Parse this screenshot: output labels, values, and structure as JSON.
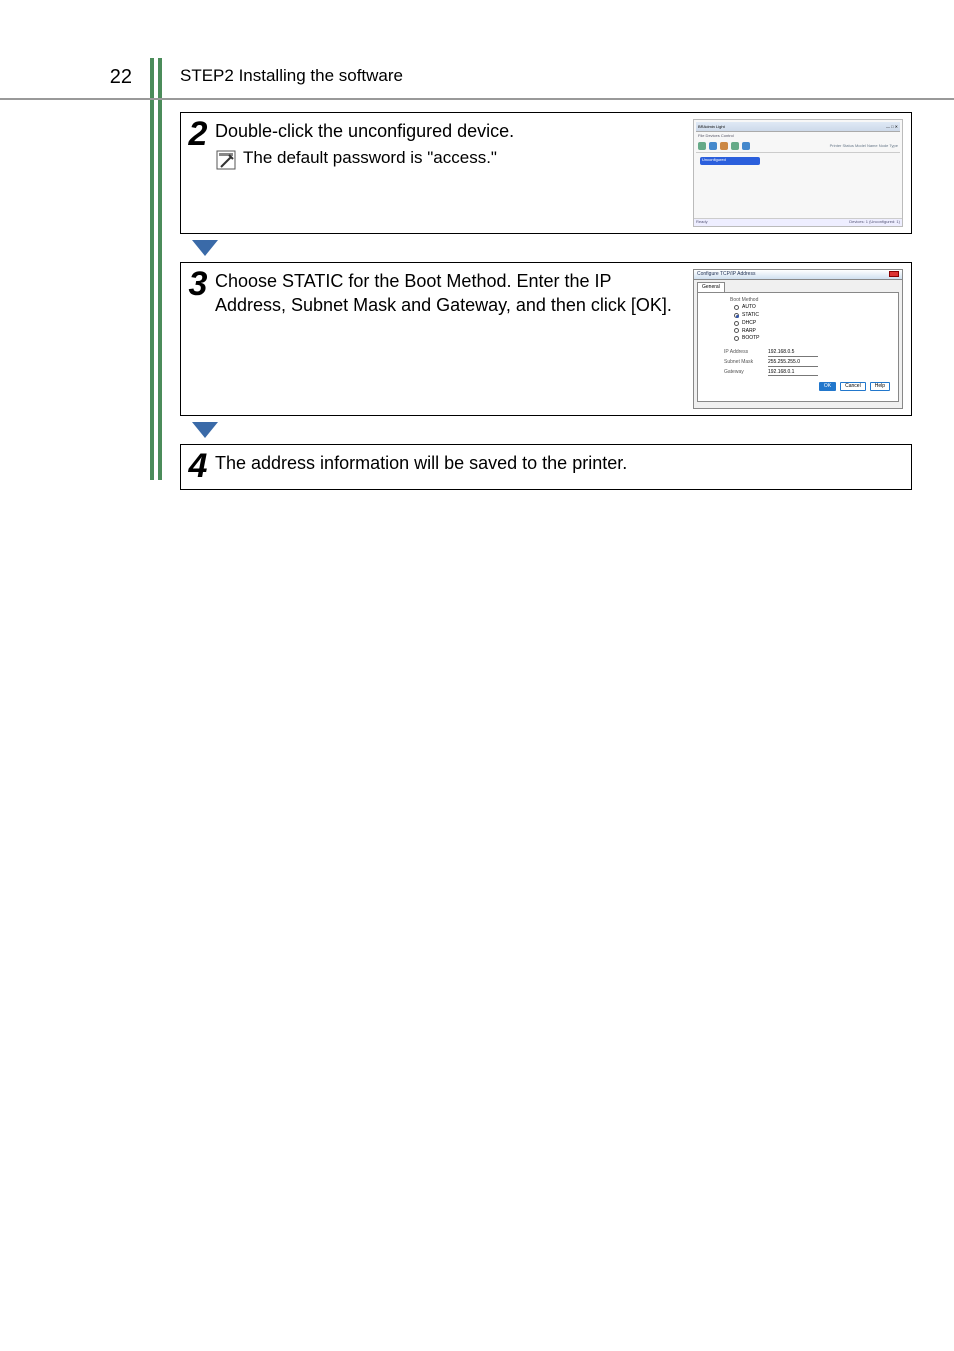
{
  "page_number": "22",
  "header_title": "STEP2 Installing the software",
  "steps": {
    "s2": {
      "num": "2",
      "text": "Double-click the unconfigured device.",
      "note": "The default password is \"access.\""
    },
    "s3": {
      "num": "3",
      "text": "Choose STATIC for the Boot Method. Enter the IP Address, Subnet Mask and Gateway, and then click [OK]."
    },
    "s4": {
      "num": "4",
      "text": "The address information will be saved to the printer."
    }
  },
  "thumb1": {
    "title": "BRAdmin Light",
    "menu": "File Devices Control",
    "cols": "Printer Status      Model Name      Node Type",
    "row": "Unconfigured",
    "status_left": "Ready",
    "status_right": "Devices: 1 (Unconfigured: 1)"
  },
  "thumb2": {
    "title": "Configure TCP/IP Address",
    "tab": "General",
    "legend": "Boot Method",
    "opts": {
      "auto": "AUTO",
      "static": "STATIC",
      "dhcp": "DHCP",
      "rarp": "RARP",
      "bootp": "BOOTP"
    },
    "ip_label": "IP Address",
    "ip_val": "192.168.0.5",
    "sm_label": "Subnet Mask",
    "sm_val": "255.255.255.0",
    "gw_label": "Gateway",
    "gw_val": "192.168.0.1",
    "ok": "OK",
    "cancel": "Cancel",
    "help": "Help"
  }
}
